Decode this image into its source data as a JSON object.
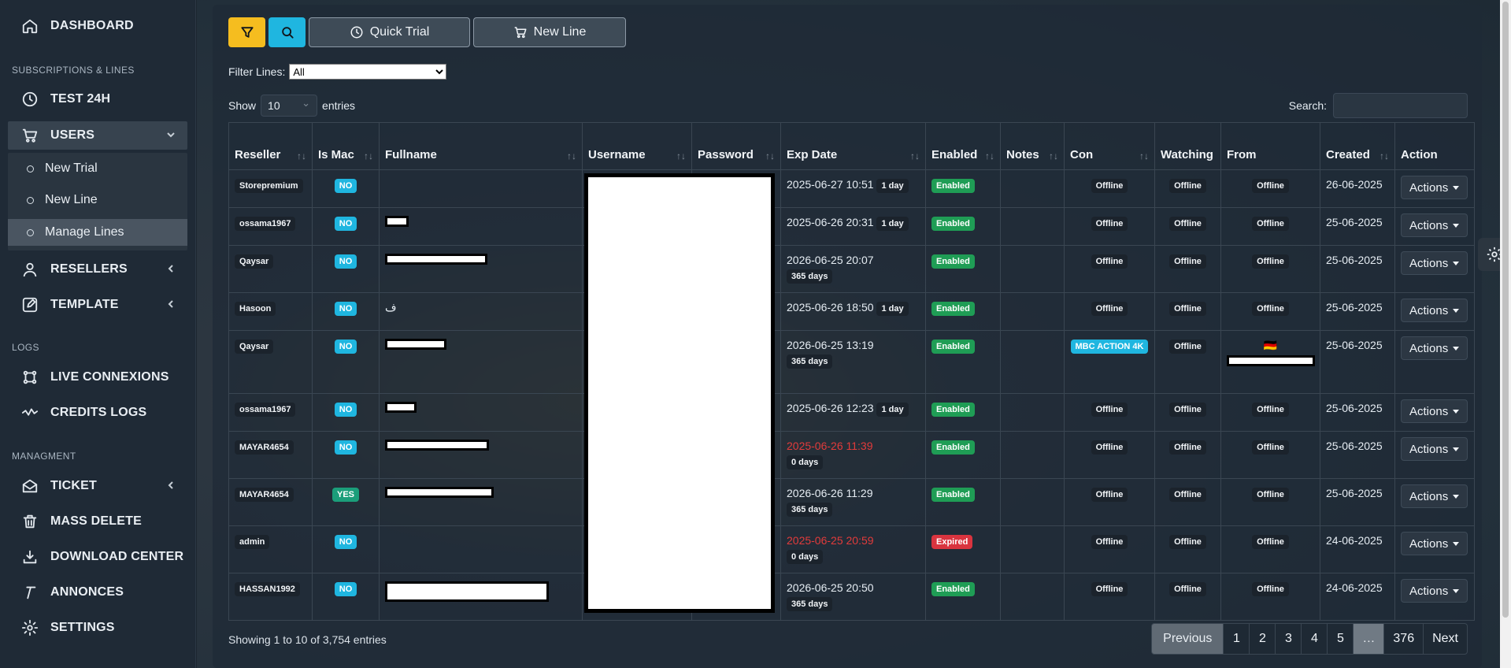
{
  "sidebar": {
    "dashboard": "DASHBOARD",
    "section_subscriptions": "SUBSCRIPTIONS & LINES",
    "test24h": "TEST 24H",
    "users": "USERS",
    "sub_items": [
      "New Trial",
      "New Line",
      "Manage Lines"
    ],
    "resellers": "RESELLERS",
    "template": "TEMPLATE",
    "section_logs": "LOGS",
    "live_connexions": "LIVE CONNEXIONS",
    "credits_logs": "CREDITS LOGS",
    "section_managment": "MANAGMENT",
    "ticket": "TICKET",
    "mass_delete": "MASS DELETE",
    "download_center": "DOWNLOAD CENTER",
    "annonces": "ANNONCES",
    "settings": "SETTINGS"
  },
  "toolbar": {
    "quick_trial": "Quick Trial",
    "new_line": "New Line",
    "filter_label": "Filter Lines:",
    "filter_value": "All",
    "show_label": "Show",
    "show_value": "10",
    "entries_label": "entries",
    "search_label": "Search:"
  },
  "table": {
    "headers": [
      "Reseller",
      "Is Mac",
      "Fullname",
      "Username",
      "Password",
      "Exp Date",
      "Enabled",
      "Notes",
      "Con",
      "Watching",
      "From",
      "Created",
      "Action"
    ],
    "rows": [
      {
        "reseller": "Storepremium",
        "mac": "NO",
        "exp": "2025-06-27 10:51",
        "days": "1 day",
        "days_inline": true,
        "expired": false,
        "enabled": "Enabled",
        "con": "Offline",
        "watching": "Offline",
        "from": "Offline",
        "created": "26-06-2025",
        "action": "Actions"
      },
      {
        "reseller": "ossama1967",
        "mac": "NO",
        "exp": "2025-06-26 20:31",
        "days": "1 day",
        "days_inline": true,
        "expired": false,
        "enabled": "Enabled",
        "con": "Offline",
        "watching": "Offline",
        "from": "Offline",
        "created": "25-06-2025",
        "action": "Actions"
      },
      {
        "reseller": "Qaysar",
        "mac": "NO",
        "exp": "2026-06-25 20:07",
        "days": "365 days",
        "days_inline": false,
        "expired": false,
        "enabled": "Enabled",
        "con": "Offline",
        "watching": "Offline",
        "from": "Offline",
        "created": "25-06-2025",
        "action": "Actions"
      },
      {
        "reseller": "Hasoon",
        "mac": "NO",
        "fullname": "ف",
        "exp": "2025-06-26 18:50",
        "days": "1 day",
        "days_inline": true,
        "expired": false,
        "enabled": "Enabled",
        "con": "Offline",
        "watching": "Offline",
        "from": "Offline",
        "created": "25-06-2025",
        "action": "Actions"
      },
      {
        "reseller": "Qaysar",
        "mac": "NO",
        "exp": "2026-06-25 13:19",
        "days": "365 days",
        "days_inline": false,
        "expired": false,
        "enabled": "Enabled",
        "con": "MBC ACTION 4K",
        "watching": "Offline",
        "from": "🇩🇪",
        "created": "25-06-2025",
        "action": "Actions"
      },
      {
        "reseller": "ossama1967",
        "mac": "NO",
        "exp": "2025-06-26 12:23",
        "days": "1 day",
        "days_inline": true,
        "expired": false,
        "enabled": "Enabled",
        "con": "Offline",
        "watching": "Offline",
        "from": "Offline",
        "created": "25-06-2025",
        "action": "Actions"
      },
      {
        "reseller": "MAYAR4654",
        "mac": "NO",
        "exp": "2025-06-26 11:39",
        "days": "0 days",
        "days_inline": false,
        "expired": true,
        "enabled": "Enabled",
        "con": "Offline",
        "watching": "Offline",
        "from": "Offline",
        "created": "25-06-2025",
        "action": "Actions"
      },
      {
        "reseller": "MAYAR4654",
        "mac": "YES",
        "exp": "2026-06-26 11:29",
        "days": "365 days",
        "days_inline": false,
        "expired": false,
        "enabled": "Enabled",
        "con": "Offline",
        "watching": "Offline",
        "from": "Offline",
        "created": "25-06-2025",
        "action": "Actions"
      },
      {
        "reseller": "admin",
        "mac": "NO",
        "exp": "2025-06-25 20:59",
        "days": "0 days",
        "days_inline": false,
        "expired": true,
        "enabled": "Expired",
        "con": "Offline",
        "watching": "Offline",
        "from": "Offline",
        "created": "24-06-2025",
        "action": "Actions"
      },
      {
        "reseller": "HASSAN1992",
        "mac": "NO",
        "exp": "2026-06-25 20:50",
        "days": "365 days",
        "days_inline": false,
        "expired": false,
        "enabled": "Enabled",
        "con": "Offline",
        "watching": "Offline",
        "from": "Offline",
        "created": "24-06-2025",
        "action": "Actions"
      }
    ]
  },
  "footer": {
    "info": "Showing 1 to 10 of 3,754 entries",
    "pages": [
      "Previous",
      "1",
      "2",
      "3",
      "4",
      "5",
      "…",
      "376",
      "Next"
    ]
  },
  "colors": {
    "accent_yellow": "#f5bd1f",
    "accent_cyan": "#1fb6e0",
    "enabled_green": "#1f9d55",
    "expired_red": "#d9343f"
  }
}
